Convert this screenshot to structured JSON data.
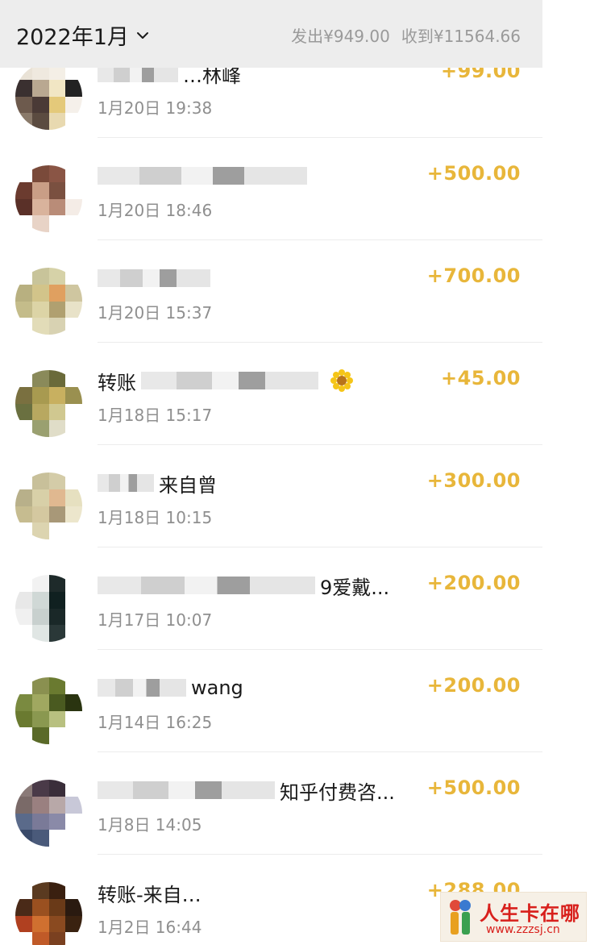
{
  "header": {
    "month": "2022年1月",
    "sent": "发出¥949.00",
    "received": "收到¥11564.66"
  },
  "transactions": [
    {
      "title": "…林峰",
      "date": "1月20日 19:38",
      "amount": "+99.00"
    },
    {
      "title": "",
      "date": "1月20日 18:46",
      "amount": "+500.00"
    },
    {
      "title": "",
      "date": "1月20日 15:37",
      "amount": "+700.00"
    },
    {
      "title": "转账",
      "date": "1月18日 15:17",
      "amount": "+45.00"
    },
    {
      "title": "来自曾",
      "date": "1月18日 10:15",
      "amount": "+300.00"
    },
    {
      "title": "9爱戴...",
      "date": "1月17日 10:07",
      "amount": "+200.00"
    },
    {
      "title": "wang",
      "date": "1月14日 16:25",
      "amount": "+200.00"
    },
    {
      "title": "知乎付费咨...",
      "date": "1月8日 14:05",
      "amount": "+500.00"
    },
    {
      "title": "转账-来自…",
      "date": "1月2日 16:44",
      "amount": "+288.00"
    }
  ],
  "watermark": {
    "brand": "人生卡在哪",
    "url": "www.zzzsj.cn"
  },
  "colors": {
    "header_bg": "#ededed",
    "amount": "#e8b63a",
    "date": "#8f8f8f",
    "watermark": "#d8201c"
  }
}
